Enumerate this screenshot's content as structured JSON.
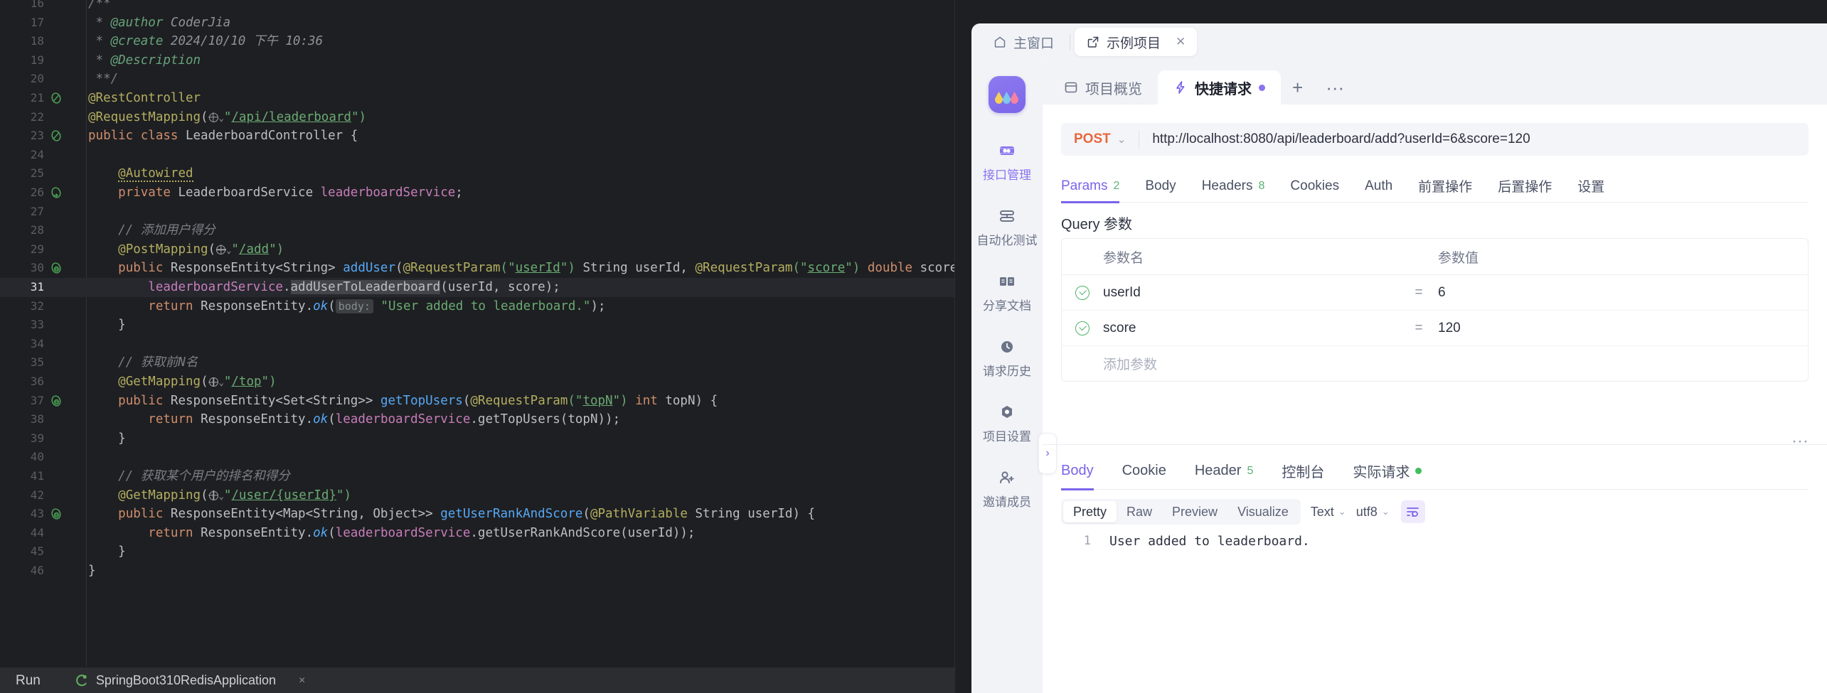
{
  "ide": {
    "code_lines": [
      {
        "num": "16",
        "gutter": "",
        "segs": [
          {
            "t": "/**",
            "c": "c-comment"
          }
        ]
      },
      {
        "num": "17",
        "gutter": "",
        "segs": [
          {
            "t": " * ",
            "c": "c-comment"
          },
          {
            "t": "@author",
            "c": "c-doctag"
          },
          {
            "t": " CoderJia",
            "c": "c-docval"
          }
        ]
      },
      {
        "num": "18",
        "gutter": "",
        "segs": [
          {
            "t": " * ",
            "c": "c-comment"
          },
          {
            "t": "@create",
            "c": "c-doctag"
          },
          {
            "t": " 2024/10/10 下午 10:36",
            "c": "c-docval"
          }
        ]
      },
      {
        "num": "19",
        "gutter": "",
        "segs": [
          {
            "t": " * ",
            "c": "c-comment"
          },
          {
            "t": "@Description",
            "c": "c-doctag"
          }
        ]
      },
      {
        "num": "20",
        "gutter": "",
        "segs": [
          {
            "t": " **/",
            "c": "c-comment"
          }
        ]
      },
      {
        "num": "21",
        "gutter": "bean",
        "segs": [
          {
            "t": "@RestController",
            "c": "c-anno"
          }
        ]
      },
      {
        "num": "22",
        "gutter": "",
        "segs": [
          {
            "t": "@RequestMapping",
            "c": "c-anno"
          },
          {
            "t": "(",
            "c": "c-ident"
          },
          {
            "t": "GLOBE",
            "c": "globe"
          },
          {
            "t": "\"",
            "c": "c-str"
          },
          {
            "t": "/api/leaderboard",
            "c": "c-strlink"
          },
          {
            "t": "\")",
            "c": "c-str"
          }
        ]
      },
      {
        "num": "23",
        "gutter": "bean",
        "segs": [
          {
            "t": "public class ",
            "c": "c-kw"
          },
          {
            "t": "LeaderboardController {",
            "c": "c-type"
          }
        ]
      },
      {
        "num": "24",
        "gutter": "",
        "segs": []
      },
      {
        "num": "25",
        "gutter": "",
        "segs": [
          {
            "t": "    ",
            "c": ""
          },
          {
            "t": "@Autowired",
            "c": "c-anno squig"
          }
        ]
      },
      {
        "num": "26",
        "gutter": "arrow",
        "segs": [
          {
            "t": "    ",
            "c": ""
          },
          {
            "t": "private ",
            "c": "c-kw"
          },
          {
            "t": "LeaderboardService ",
            "c": "c-type"
          },
          {
            "t": "leaderboardService",
            "c": "c-field"
          },
          {
            "t": ";",
            "c": "c-ident"
          }
        ]
      },
      {
        "num": "27",
        "gutter": "",
        "segs": []
      },
      {
        "num": "28",
        "gutter": "",
        "segs": [
          {
            "t": "    // 添加用户得分",
            "c": "c-comment"
          }
        ]
      },
      {
        "num": "29",
        "gutter": "",
        "segs": [
          {
            "t": "    ",
            "c": ""
          },
          {
            "t": "@PostMapping",
            "c": "c-anno"
          },
          {
            "t": "(",
            "c": "c-ident"
          },
          {
            "t": "GLOBE",
            "c": "globe"
          },
          {
            "t": "\"",
            "c": "c-str"
          },
          {
            "t": "/add",
            "c": "c-strlink"
          },
          {
            "t": "\")",
            "c": "c-str"
          }
        ]
      },
      {
        "num": "30",
        "gutter": "web",
        "segs": [
          {
            "t": "    ",
            "c": ""
          },
          {
            "t": "public ",
            "c": "c-kw"
          },
          {
            "t": "ResponseEntity<String> ",
            "c": "c-type"
          },
          {
            "t": "addUser",
            "c": "c-method"
          },
          {
            "t": "(",
            "c": "c-ident"
          },
          {
            "t": "@RequestParam",
            "c": "c-anno"
          },
          {
            "t": "(\"",
            "c": "c-str"
          },
          {
            "t": "userId",
            "c": "c-strlink"
          },
          {
            "t": "\") ",
            "c": "c-str"
          },
          {
            "t": "String ",
            "c": "c-type"
          },
          {
            "t": "userId, ",
            "c": "c-param"
          },
          {
            "t": "@RequestParam",
            "c": "c-anno"
          },
          {
            "t": "(\"",
            "c": "c-str"
          },
          {
            "t": "score",
            "c": "c-strlink"
          },
          {
            "t": "\") ",
            "c": "c-str"
          },
          {
            "t": "double ",
            "c": "c-kw"
          },
          {
            "t": "score",
            "c": "c-param"
          },
          {
            "t": ") {",
            "c": "c-ident"
          }
        ]
      },
      {
        "num": "31",
        "gutter": "",
        "highlight": true,
        "segs": [
          {
            "t": "        ",
            "c": ""
          },
          {
            "t": "leaderboardService",
            "c": "c-field"
          },
          {
            "t": ".",
            "c": "c-ident"
          },
          {
            "t": "addUserToLeaderboard",
            "c": "c-ident c-selbg"
          },
          {
            "t": "(userId, score);",
            "c": "c-ident"
          }
        ]
      },
      {
        "num": "32",
        "gutter": "",
        "segs": [
          {
            "t": "        ",
            "c": ""
          },
          {
            "t": "return ",
            "c": "c-kw"
          },
          {
            "t": "ResponseEntity.",
            "c": "c-type"
          },
          {
            "t": "ok",
            "c": "c-method c-italic"
          },
          {
            "t": "(",
            "c": "c-ident"
          },
          {
            "t": "HINT:body:",
            "c": "hint"
          },
          {
            "t": " \"User added to leaderboard.\"",
            "c": "c-str"
          },
          {
            "t": ");",
            "c": "c-ident"
          }
        ]
      },
      {
        "num": "33",
        "gutter": "",
        "segs": [
          {
            "t": "    }",
            "c": "c-ident"
          }
        ]
      },
      {
        "num": "34",
        "gutter": "",
        "segs": []
      },
      {
        "num": "35",
        "gutter": "",
        "segs": [
          {
            "t": "    // 获取前N名",
            "c": "c-comment"
          }
        ]
      },
      {
        "num": "36",
        "gutter": "",
        "segs": [
          {
            "t": "    ",
            "c": ""
          },
          {
            "t": "@GetMapping",
            "c": "c-anno"
          },
          {
            "t": "(",
            "c": "c-ident"
          },
          {
            "t": "GLOBE",
            "c": "globe"
          },
          {
            "t": "\"",
            "c": "c-str"
          },
          {
            "t": "/top",
            "c": "c-strlink"
          },
          {
            "t": "\")",
            "c": "c-str"
          }
        ]
      },
      {
        "num": "37",
        "gutter": "web",
        "segs": [
          {
            "t": "    ",
            "c": ""
          },
          {
            "t": "public ",
            "c": "c-kw"
          },
          {
            "t": "ResponseEntity<Set<String>> ",
            "c": "c-type"
          },
          {
            "t": "getTopUsers",
            "c": "c-method"
          },
          {
            "t": "(",
            "c": "c-ident"
          },
          {
            "t": "@RequestParam",
            "c": "c-anno"
          },
          {
            "t": "(\"",
            "c": "c-str"
          },
          {
            "t": "topN",
            "c": "c-strlink"
          },
          {
            "t": "\") ",
            "c": "c-str"
          },
          {
            "t": "int ",
            "c": "c-kw"
          },
          {
            "t": "topN",
            "c": "c-param"
          },
          {
            "t": ") {",
            "c": "c-ident"
          }
        ]
      },
      {
        "num": "38",
        "gutter": "",
        "segs": [
          {
            "t": "        ",
            "c": ""
          },
          {
            "t": "return ",
            "c": "c-kw"
          },
          {
            "t": "ResponseEntity.",
            "c": "c-type"
          },
          {
            "t": "ok",
            "c": "c-method c-italic"
          },
          {
            "t": "(",
            "c": "c-ident"
          },
          {
            "t": "leaderboardService",
            "c": "c-field"
          },
          {
            "t": ".getTopUsers(topN));",
            "c": "c-ident"
          }
        ]
      },
      {
        "num": "39",
        "gutter": "",
        "segs": [
          {
            "t": "    }",
            "c": "c-ident"
          }
        ]
      },
      {
        "num": "40",
        "gutter": "",
        "segs": []
      },
      {
        "num": "41",
        "gutter": "",
        "segs": [
          {
            "t": "    // 获取某个用户的排名和得分",
            "c": "c-comment"
          }
        ]
      },
      {
        "num": "42",
        "gutter": "",
        "segs": [
          {
            "t": "    ",
            "c": ""
          },
          {
            "t": "@GetMapping",
            "c": "c-anno"
          },
          {
            "t": "(",
            "c": "c-ident"
          },
          {
            "t": "GLOBE",
            "c": "globe"
          },
          {
            "t": "\"",
            "c": "c-str"
          },
          {
            "t": "/user/{userId}",
            "c": "c-strlink"
          },
          {
            "t": "\")",
            "c": "c-str"
          }
        ]
      },
      {
        "num": "43",
        "gutter": "web",
        "segs": [
          {
            "t": "    ",
            "c": ""
          },
          {
            "t": "public ",
            "c": "c-kw"
          },
          {
            "t": "ResponseEntity<Map<String, Object>> ",
            "c": "c-type"
          },
          {
            "t": "getUserRankAndScore",
            "c": "c-method"
          },
          {
            "t": "(",
            "c": "c-ident"
          },
          {
            "t": "@PathVariable",
            "c": "c-anno"
          },
          {
            "t": " String ",
            "c": "c-type"
          },
          {
            "t": "userId",
            "c": "c-param"
          },
          {
            "t": ") {",
            "c": "c-ident"
          }
        ]
      },
      {
        "num": "44",
        "gutter": "",
        "segs": [
          {
            "t": "        ",
            "c": ""
          },
          {
            "t": "return ",
            "c": "c-kw"
          },
          {
            "t": "ResponseEntity.",
            "c": "c-type"
          },
          {
            "t": "ok",
            "c": "c-method c-italic"
          },
          {
            "t": "(",
            "c": "c-ident"
          },
          {
            "t": "leaderboardService",
            "c": "c-field"
          },
          {
            "t": ".getUserRankAndScore(userId));",
            "c": "c-ident"
          }
        ]
      },
      {
        "num": "45",
        "gutter": "",
        "segs": [
          {
            "t": "    }",
            "c": "c-ident"
          }
        ]
      },
      {
        "num": "46",
        "gutter": "",
        "segs": [
          {
            "t": "}",
            "c": "c-ident"
          }
        ]
      }
    ],
    "run": {
      "label": "Run",
      "config_name": "SpringBoot310RedisApplication",
      "close": "×"
    }
  },
  "apifox": {
    "window_tabs": [
      {
        "label": "主窗口",
        "icon": "home-icon",
        "active": false,
        "closable": false
      },
      {
        "label": "示例项目",
        "icon": "external-link-icon",
        "active": true,
        "closable": true,
        "close": "✕"
      }
    ],
    "rail": [
      {
        "label": "接口管理",
        "icon": "api-manage-icon",
        "active": true
      },
      {
        "label": "自动化测试",
        "icon": "automation-test-icon",
        "active": false
      },
      {
        "label": "分享文档",
        "icon": "share-doc-icon",
        "active": false
      },
      {
        "label": "请求历史",
        "icon": "clock-icon",
        "active": false
      },
      {
        "label": "项目设置",
        "icon": "settings-icon",
        "active": false
      },
      {
        "label": "邀请成员",
        "icon": "invite-member-icon",
        "active": false
      }
    ],
    "panel_tabs": [
      {
        "label": "项目概览",
        "icon": "overview-icon",
        "active": false,
        "dot": false
      },
      {
        "label": "快捷请求",
        "icon": "lightning-icon",
        "active": true,
        "dot": true
      }
    ],
    "panel_tab_plus": "+",
    "panel_tab_more": "···",
    "request": {
      "method": "POST",
      "method_chevron": "⌄",
      "url": "http://localhost:8080/api/leaderboard/add?userId=6&score=120",
      "tabs": [
        {
          "label": "Params",
          "badge": "2",
          "active": true
        },
        {
          "label": "Body",
          "badge": "",
          "active": false
        },
        {
          "label": "Headers",
          "badge": "8",
          "active": false
        },
        {
          "label": "Cookies",
          "badge": "",
          "active": false
        },
        {
          "label": "Auth",
          "badge": "",
          "active": false
        },
        {
          "label": "前置操作",
          "badge": "",
          "active": false
        },
        {
          "label": "后置操作",
          "badge": "",
          "active": false
        },
        {
          "label": "设置",
          "badge": "",
          "active": false
        }
      ],
      "query_title": "Query 参数",
      "table": {
        "headers": {
          "name": "参数名",
          "value": "参数值"
        },
        "rows": [
          {
            "checked": true,
            "name": "userId",
            "eq": "=",
            "value": "6"
          },
          {
            "checked": true,
            "name": "score",
            "eq": "=",
            "value": "120"
          }
        ],
        "add_row_placeholder": "添加参数"
      }
    },
    "collapse_handle": "›",
    "response": {
      "more": "···",
      "tabs": [
        {
          "label": "Body",
          "badge": "",
          "active": true,
          "dot": false
        },
        {
          "label": "Cookie",
          "badge": "",
          "active": false,
          "dot": false
        },
        {
          "label": "Header",
          "badge": "5",
          "active": false,
          "dot": false
        },
        {
          "label": "控制台",
          "badge": "",
          "active": false,
          "dot": false
        },
        {
          "label": "实际请求",
          "badge": "",
          "active": false,
          "dot": true
        }
      ],
      "format_buttons": [
        {
          "label": "Pretty",
          "active": true
        },
        {
          "label": "Raw",
          "active": false
        },
        {
          "label": "Preview",
          "active": false
        },
        {
          "label": "Visualize",
          "active": false
        }
      ],
      "type_select": {
        "label": "Text",
        "chevron": "⌄"
      },
      "encoding_select": {
        "label": "utf8",
        "chevron": "⌄"
      },
      "wrap_icon": "word-wrap-icon",
      "body_lines": [
        {
          "num": "1",
          "text": "User added to leaderboard."
        }
      ]
    }
  },
  "colors": {
    "accent": "#7b63ea",
    "method_post": "#e8673c",
    "success_green": "#52b46a",
    "ide_bg": "#1e1f22"
  }
}
